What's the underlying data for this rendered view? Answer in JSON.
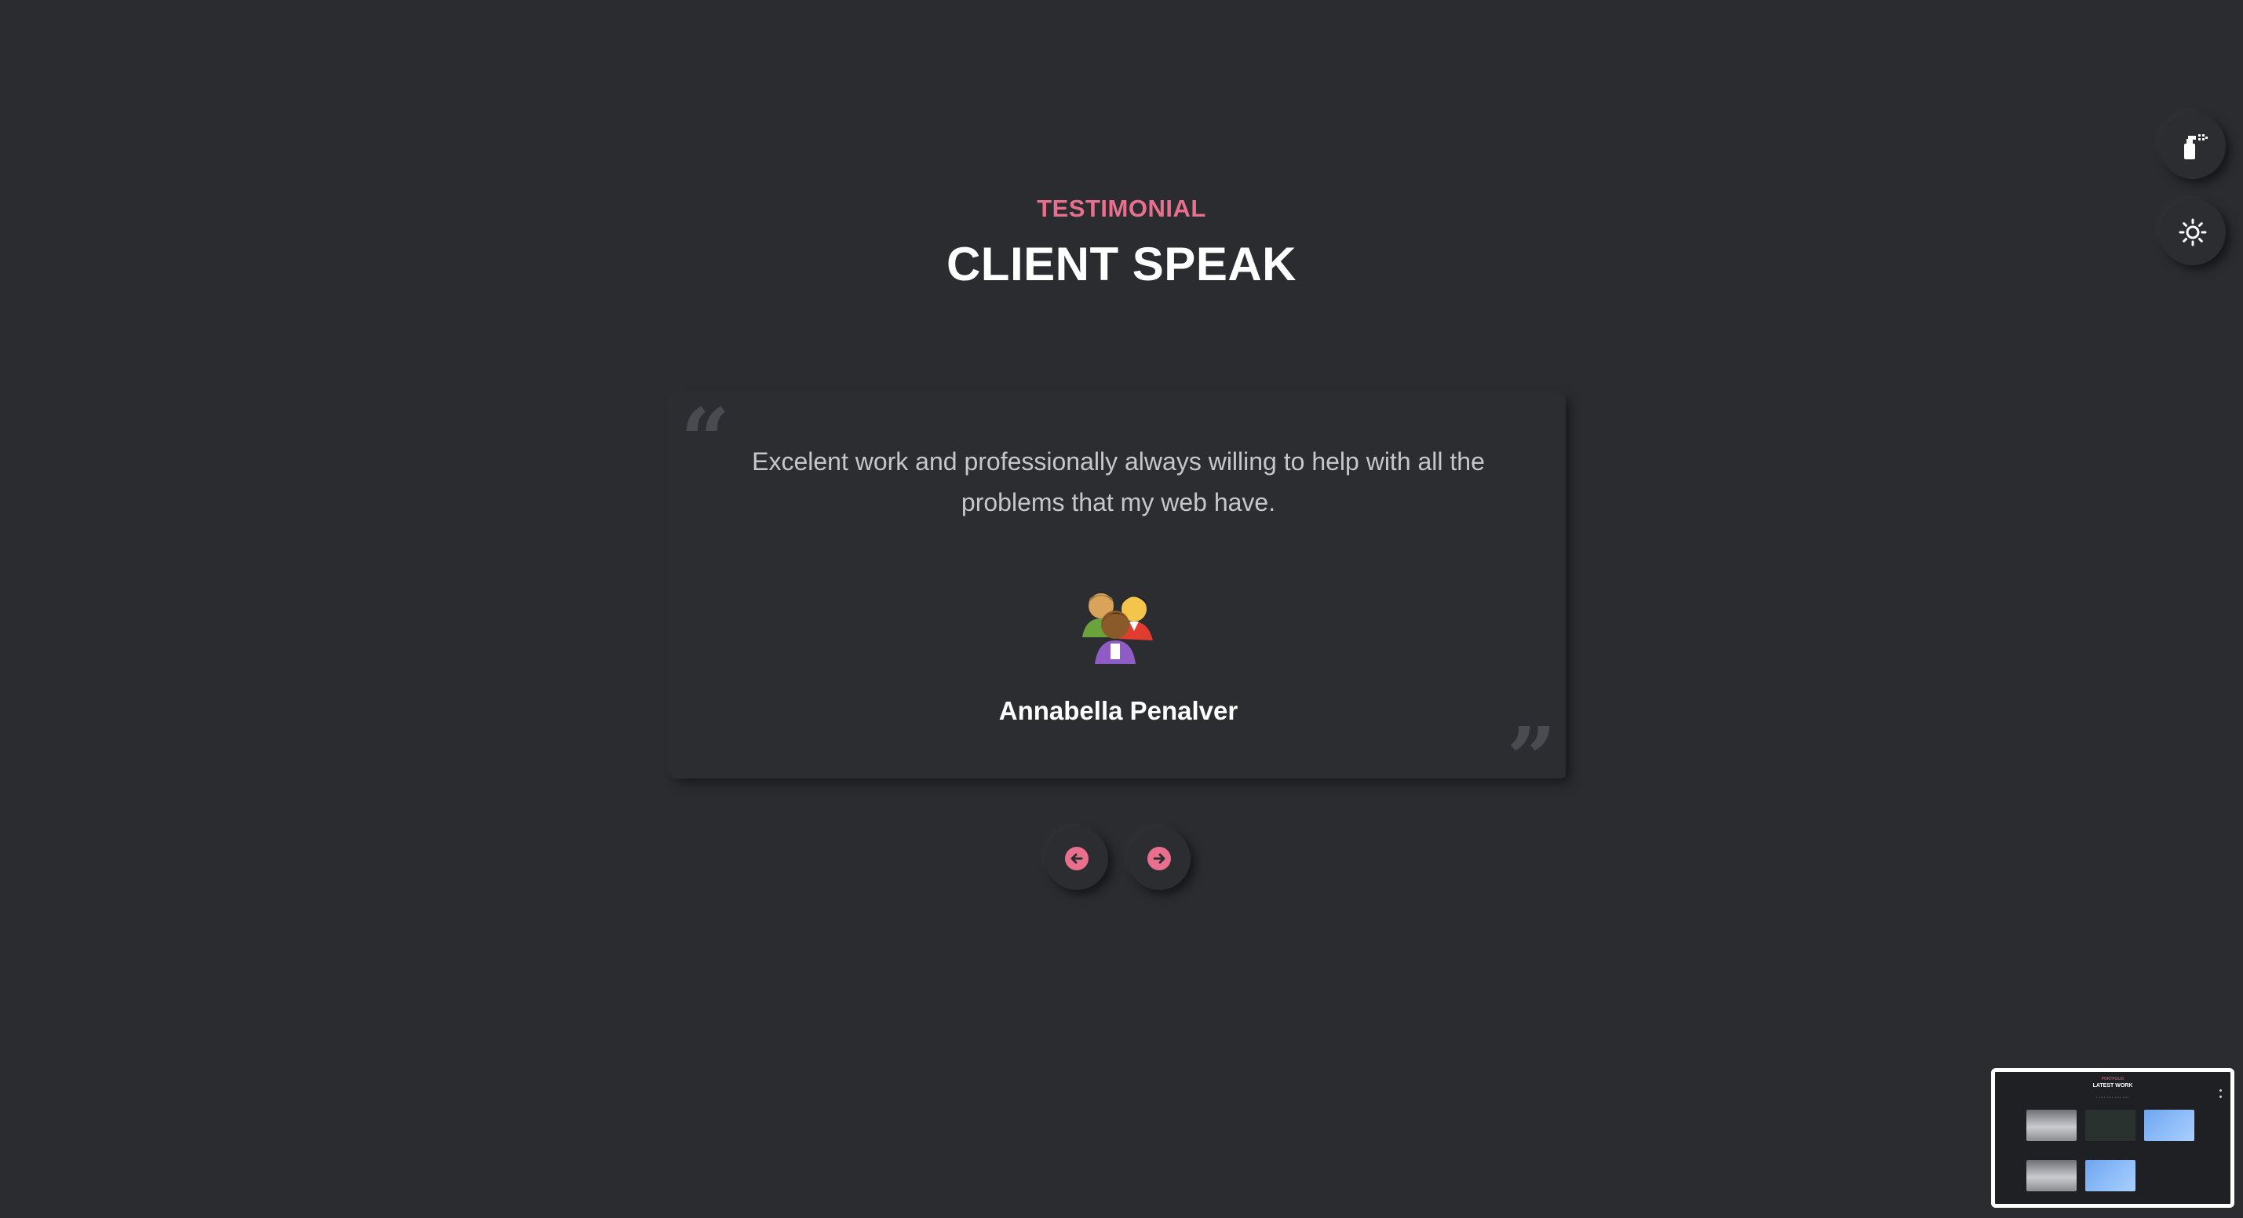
{
  "section": {
    "kicker": "TESTIMONIAL",
    "title": "CLIENT SPEAK"
  },
  "testimonial": {
    "text": "Excelent work and professionally always willing to help with all the problems that my web have.",
    "client_name": "Annabella Penalver",
    "avatar_icon": "users-group-avatar"
  },
  "navigation": {
    "prev_icon": "arrow-left-circle-icon",
    "next_icon": "arrow-right-circle-icon"
  },
  "side_controls": {
    "color_picker_icon": "spray-can-icon",
    "theme_toggle_icon": "sun-icon"
  },
  "minimap": {
    "kicker": "PORTFOLIO",
    "title": "LATEST WORK"
  },
  "colors": {
    "background": "#2b2c30",
    "accent": "#e8708e",
    "text": "#ffffff",
    "muted_text": "#c6c7cb"
  }
}
